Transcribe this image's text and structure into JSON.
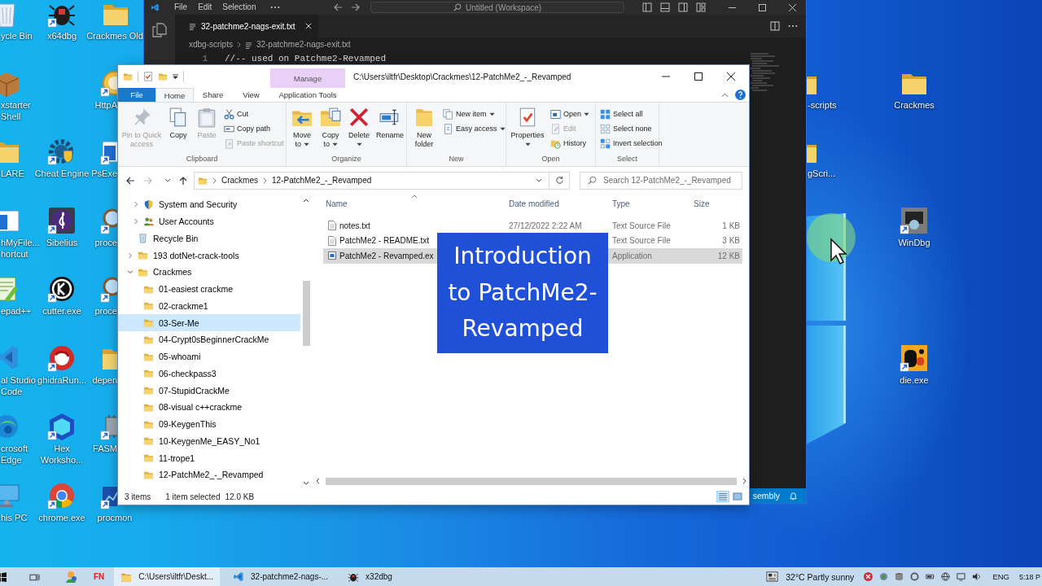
{
  "desktop_columns": [
    {
      "icons": [
        {
          "label": "ycle Bin"
        },
        {
          "label": "xstarter\nShell"
        },
        {
          "label": "LARE"
        },
        {
          "label": "hMyFile...\nhortcut"
        },
        {
          "label": "epad++"
        },
        {
          "label": "al Studio\nCode"
        },
        {
          "label": "crosoft\nEdge"
        },
        {
          "label": "his PC"
        }
      ]
    },
    {
      "icons": [
        {
          "label": "x64dbg",
          "shortcut": true
        },
        {
          "label": "Cheat Engine",
          "shortcut": true
        },
        {
          "label": "Sibelius",
          "shortcut": true
        },
        {
          "label": "cutter.exe",
          "shortcut": true
        },
        {
          "label": "ghidraRun...",
          "shortcut": true
        },
        {
          "label": "Hex\nWorksho...",
          "shortcut": true
        },
        {
          "label": "chrome.exe",
          "shortcut": true
        }
      ]
    },
    {
      "icons": [
        {
          "label": "Crackmes Old",
          "shortcut": false
        },
        {
          "label": "HttpA",
          "shortcut": true
        },
        {
          "label": "PsExe",
          "shortcut": true
        },
        {
          "label": "proce",
          "shortcut": true
        },
        {
          "label": "proce",
          "shortcut": true
        },
        {
          "label": "depen",
          "shortcut": false
        },
        {
          "label": "FASM",
          "shortcut": true
        },
        {
          "label": "procmon",
          "shortcut": true
        }
      ]
    },
    {
      "icons": [
        {
          "label": "-scripts"
        },
        {
          "label": "gScri..."
        }
      ]
    },
    {
      "icons": [
        {
          "label": "Crackmes",
          "shortcut": false
        },
        {
          "label": "WinDbg",
          "shortcut": true
        },
        {
          "label": "die.exe",
          "shortcut": true
        }
      ]
    }
  ],
  "code_editor": {
    "menu": [
      "File",
      "Edit",
      "Selection"
    ],
    "command_center": "Untitled (Workspace)",
    "tabs": [
      {
        "label": "32-patchme2-nags-exit.txt",
        "selected": true
      }
    ],
    "breadcrumb": [
      "xdbg-scripts",
      "32-patchme2-nags-exit.txt"
    ],
    "lines": [
      {
        "number": "1",
        "text": "//-- used on Patchme2-Revamped"
      }
    ],
    "status_bar": {
      "language": "sembly"
    }
  },
  "file_explorer": {
    "context_tab_group": "Manage",
    "title": "C:\\Users\\iltfr\\Desktop\\Crackmes\\12-PatchMe2_-_Revamped",
    "ribbon_tabs": [
      {
        "label": "File",
        "kind": "file",
        "selected": false
      },
      {
        "label": "Home",
        "kind": "normal",
        "selected": true
      },
      {
        "label": "Share",
        "kind": "normal",
        "selected": false
      },
      {
        "label": "View",
        "kind": "normal",
        "selected": false
      },
      {
        "label": "Application Tools",
        "kind": "context",
        "selected": false
      }
    ],
    "ribbon_groups": [
      {
        "label": "Clipboard",
        "large_buttons": [
          {
            "label": "Pin to Quick access",
            "disabled": true,
            "dropdown": false
          },
          {
            "label": "Copy",
            "disabled": false,
            "dropdown": false
          },
          {
            "label": "Paste",
            "disabled": true,
            "dropdown": false
          }
        ],
        "small_buttons": [
          {
            "label": "Cut",
            "disabled": false,
            "dropdown": false
          },
          {
            "label": "Copy path",
            "disabled": false,
            "dropdown": false
          },
          {
            "label": "Paste shortcut",
            "disabled": true,
            "dropdown": false
          }
        ]
      },
      {
        "label": "Organize",
        "large_buttons": [
          {
            "label": "Move to",
            "disabled": false,
            "dropdown": true
          },
          {
            "label": "Copy to",
            "disabled": false,
            "dropdown": true
          },
          {
            "label": "Delete",
            "disabled": false,
            "dropdown": true
          },
          {
            "label": "Rename",
            "disabled": false,
            "dropdown": false
          }
        ]
      },
      {
        "label": "New",
        "large_buttons": [
          {
            "label": "New folder",
            "disabled": false,
            "dropdown": false
          }
        ],
        "small_buttons": [
          {
            "label": "New item",
            "disabled": false,
            "dropdown": true
          },
          {
            "label": "Easy access",
            "disabled": false,
            "dropdown": true
          }
        ]
      },
      {
        "label": "Open",
        "large_buttons": [
          {
            "label": "Properties",
            "disabled": false,
            "dropdown": true
          }
        ],
        "small_buttons": [
          {
            "label": "Open",
            "disabled": false,
            "dropdown": true
          },
          {
            "label": "Edit",
            "disabled": true,
            "dropdown": false
          },
          {
            "label": "History",
            "disabled": false,
            "dropdown": false
          }
        ]
      },
      {
        "label": "Select",
        "small_buttons": [
          {
            "label": "Select all",
            "disabled": false,
            "dropdown": false
          },
          {
            "label": "Select none",
            "disabled": false,
            "dropdown": false
          },
          {
            "label": "Invert selection",
            "disabled": false,
            "dropdown": false
          }
        ]
      }
    ],
    "address_bar": {
      "back_disabled": false,
      "forward_disabled": true,
      "path": [
        "Crackmes",
        "12-PatchMe2_-_Revamped"
      ]
    },
    "search": {
      "placeholder": "Search 12-PatchMe2_-_Revamped"
    },
    "navigation_pane": {
      "tree": [
        {
          "children": [
            {
              "label": "System and Security",
              "kind": "settings",
              "expanded": false,
              "selected": false
            },
            {
              "label": "User Accounts",
              "kind": "accounts",
              "expanded": false,
              "selected": false
            }
          ]
        },
        {
          "label": "Recycle Bin",
          "kind": "bin",
          "selected": false
        },
        {
          "label": "193 dotNet-crack-tools",
          "kind": "folder",
          "expanded": false,
          "selected": false
        },
        {
          "label": "Crackmes",
          "kind": "folder",
          "expanded": true,
          "selected": false,
          "children": [
            {
              "label": "01-easiest crackme",
              "kind": "folder",
              "selected": false
            },
            {
              "label": "02-crackme1",
              "kind": "folder",
              "selected": false
            },
            {
              "label": "03-Ser-Me",
              "kind": "folder",
              "selected": true
            },
            {
              "label": "04-Crypt0sBeginnerCrackMe",
              "kind": "folder",
              "selected": false
            },
            {
              "label": "05-whoami",
              "kind": "folder",
              "selected": false
            },
            {
              "label": "06-checkpass3",
              "kind": "folder",
              "selected": false
            },
            {
              "label": "07-StupidCrackMe",
              "kind": "folder",
              "selected": false
            },
            {
              "label": "08-visual c++crackme",
              "kind": "folder",
              "selected": false
            },
            {
              "label": "09-KeygenThis",
              "kind": "folder",
              "selected": false
            },
            {
              "label": "10-KeygenMe_EASY_No1",
              "kind": "folder",
              "selected": false
            },
            {
              "label": "11-trope1",
              "kind": "folder",
              "selected": false
            },
            {
              "label": "12-PatchMe2_-_Revamped",
              "kind": "folder",
              "selected": false
            }
          ]
        }
      ]
    },
    "file_list": {
      "columns": [
        {
          "label": "Name",
          "sorted": true
        },
        {
          "label": "Date modified",
          "sorted": false
        },
        {
          "label": "Type",
          "sorted": false
        },
        {
          "label": "Size",
          "sorted": false
        }
      ],
      "rows": [
        {
          "name": "notes.txt",
          "kind": "text",
          "date_modified": "27/12/2022 2:22 AM",
          "type": "Text Source File",
          "size": "1 KB",
          "selected": false
        },
        {
          "name": "PatchMe2 - README.txt",
          "kind": "text",
          "type": "Text Source File",
          "size": "3 KB",
          "selected": false
        },
        {
          "name": "PatchMe2 - Revamped.ex",
          "kind": "app",
          "type": "Application",
          "size": "12 KB",
          "selected": true
        }
      ]
    },
    "status_bar": {
      "item_count": "3 items",
      "selection": "1 item selected",
      "selection_size": "12.0 KB",
      "view_buttons": [
        {
          "selected": true
        },
        {
          "selected": false
        }
      ]
    }
  },
  "lecture_overlay": {
    "title": "Introduction to PatchMe2-Revamped"
  },
  "taskbar": {
    "pinned_app_label": "FN",
    "windows": [
      {
        "label": "C:\\Users\\iltfr\\Deskt...",
        "kind": "folder",
        "selected": true
      },
      {
        "label": "32-patchme2-nags-...",
        "kind": "editor",
        "selected": false
      },
      {
        "label": "x32dbg",
        "kind": "debugger",
        "selected": false
      }
    ],
    "weather": {
      "temperature": "32°C",
      "condition": "Partly sunny"
    },
    "language": "ENG",
    "clock": "5:18 P"
  }
}
